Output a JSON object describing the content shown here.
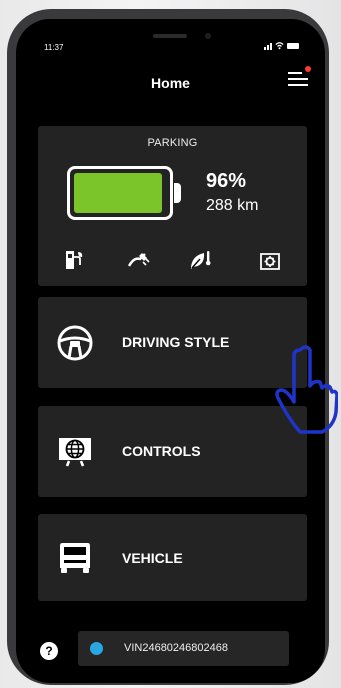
{
  "status_bar": {
    "time": "11:37"
  },
  "header": {
    "title": "Home"
  },
  "parking": {
    "label": "PARKING",
    "battery_level": 0.96,
    "percent": "96%",
    "range": "288 km"
  },
  "menu_buttons": [
    {
      "label": "DRIVING STYLE",
      "icon": "steering-wheel-icon"
    },
    {
      "label": "CONTROLS",
      "icon": "globe-screen-icon"
    },
    {
      "label": "VEHICLE",
      "icon": "van-icon"
    }
  ],
  "footer": {
    "help": "?",
    "vin": "VIN24680246802468"
  },
  "colors": {
    "battery": "#7bc42a",
    "status_dot": "#29a7e1",
    "notification": "#ff3b30"
  }
}
